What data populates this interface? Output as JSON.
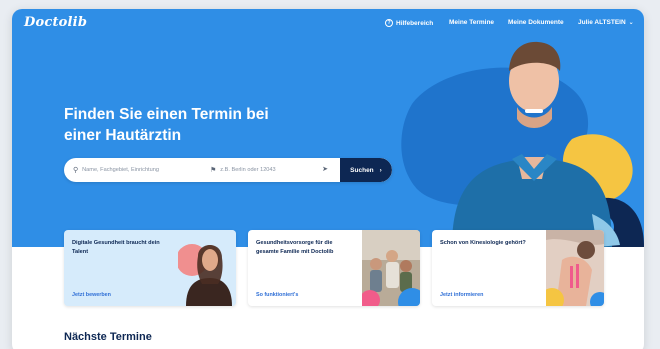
{
  "brand": {
    "logo_text": "Doctolib",
    "primary_color": "#2f8ee6",
    "dark_color": "#0d2753"
  },
  "nav": {
    "help_icon": "help-circle-icon",
    "help": "Hilfebereich",
    "appointments": "Meine Termine",
    "documents": "Meine Dokumente",
    "user": "Julie ALTSTEIN",
    "user_icon": "chevron-down-icon"
  },
  "hero": {
    "headline_line1": "Finden Sie einen Termin bei",
    "headline_line2": "einer Hautärztin"
  },
  "search": {
    "query_icon": "search-icon",
    "query_placeholder": "Name, Fachgebiet, Einrichtung",
    "location_icon": "map-pin-icon",
    "location_placeholder": "z.B. Berlin oder 12043",
    "locate_icon": "navigation-arrow-icon",
    "button_label": "Suchen",
    "button_icon": "chevron-right-icon"
  },
  "cards": [
    {
      "title": "Digitale Gesundheit braucht dein Talent",
      "link": "Jetzt bewerben"
    },
    {
      "title": "Gesundheitsvorsorge für die gesamte Familie mit Doctolib",
      "link": "So funktioniert's"
    },
    {
      "title": "Schon von Kinesiologie gehört?",
      "link": "Jetzt informieren"
    }
  ],
  "section": {
    "next_appointments": "Nächste Termine"
  }
}
